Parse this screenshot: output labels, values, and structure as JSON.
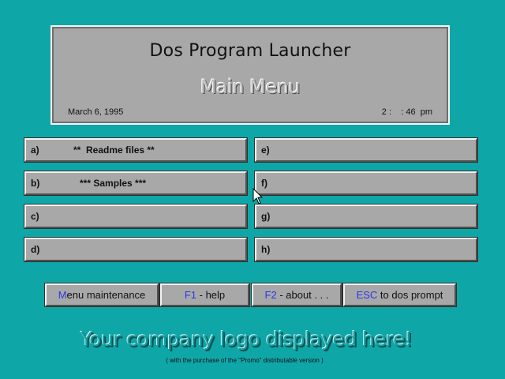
{
  "header": {
    "app_title": "Dos Program Launcher",
    "menu_title": "Main Menu",
    "date": "March 6, 1995",
    "time": "2 :    : 46  pm"
  },
  "slots": [
    {
      "key": "a)",
      "label": "**  Readme files **"
    },
    {
      "key": "b)",
      "label": "*** Samples ***"
    },
    {
      "key": "c)",
      "label": ""
    },
    {
      "key": "d)",
      "label": ""
    },
    {
      "key": "e)",
      "label": ""
    },
    {
      "key": "f)",
      "label": ""
    },
    {
      "key": "g)",
      "label": ""
    },
    {
      "key": "h)",
      "label": ""
    }
  ],
  "buttons": {
    "menu_maintenance": {
      "hotkey": "M",
      "rest": "enu maintenance"
    },
    "help": {
      "hotkey": "F1",
      "rest": " - help"
    },
    "about": {
      "hotkey": "F2",
      "rest": " - about . . ."
    },
    "dos_prompt": {
      "hotkey": "ESC",
      "rest": " to dos prompt"
    }
  },
  "footer": {
    "logo_text": "Your company logo displayed here!",
    "promo_note": "( with the purchase of the \"Promo\" distributable version )"
  },
  "colors": {
    "desktop": "#0fa6a8",
    "panel": "#a8a8a8",
    "hotkey": "#2a38e8"
  },
  "icons": {
    "cursor": "arrow-pointer-icon"
  }
}
